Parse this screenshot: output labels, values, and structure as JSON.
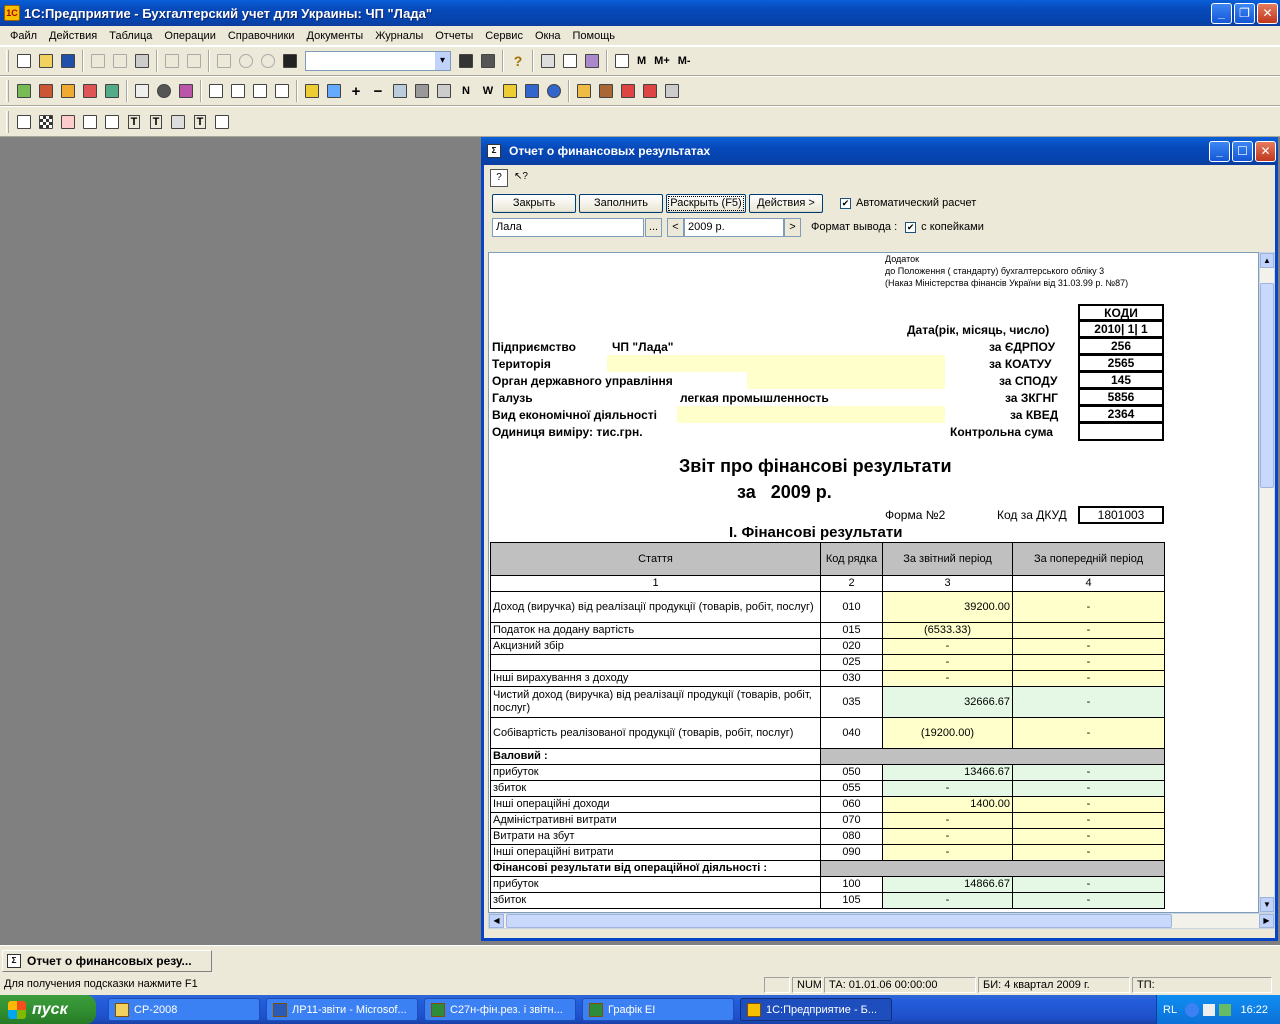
{
  "app": {
    "title": "1С:Предприятие - Бухгалтерский учет для Украины: ЧП \"Лада\"",
    "icon": "1c-app-icon"
  },
  "menu": [
    "Файл",
    "Действия",
    "Таблица",
    "Операции",
    "Справочники",
    "Документы",
    "Журналы",
    "Отчеты",
    "Сервис",
    "Окна",
    "Помощь"
  ],
  "toolbar": {
    "text_buttons": [
      "M",
      "M+",
      "M-"
    ]
  },
  "report_window": {
    "title": "Отчет о финансовых результатах",
    "buttons": {
      "close": "Закрыть",
      "fill": "Заполнить",
      "expand": "Раскрыть (F5)",
      "actions": "Действия >"
    },
    "auto_calc_label": "Автоматический расчет",
    "auto_calc_checked": true,
    "company_value": "Лала",
    "company_select": "...",
    "period_prev": "<",
    "period_value": "2009 р.",
    "period_next": ">",
    "output_format_label": "Формат вывода :",
    "kopecks_label": "с копейками",
    "kopecks_checked": true
  },
  "report": {
    "appendix": [
      "Додаток",
      "до Положення ( стандарту) бухгалтерського обліку 3",
      "(Наказ Міністерства фінансів України від 31.03.99 р. №87)"
    ],
    "codes_header": "КОДИ",
    "date_label": "Дата(рік, місяць, число)",
    "date_value": "2010| 1| 1",
    "rows": [
      {
        "label": "Підприємство",
        "value": "ЧП \"Лада\"",
        "code_label": "за ЄДРПОУ",
        "code": "256"
      },
      {
        "label": "Територія",
        "value": "",
        "code_label": "за  КОАТУУ",
        "code": "2565"
      },
      {
        "label": "Орган державного управління",
        "value": "",
        "code_label": "за СПОДУ",
        "code": "145"
      },
      {
        "label": "Галузь",
        "value": "легкая промышленность",
        "code_label": "за ЗКГНГ",
        "code": "5856"
      },
      {
        "label": "Вид економічної діяльності",
        "value": "",
        "code_label": "за КВЕД",
        "code": "2364"
      },
      {
        "label": "Одиниця виміру: тис.грн.",
        "value": "",
        "code_label": "Контрольна сума",
        "code": ""
      }
    ],
    "title": "Звіт про фінансові результати",
    "subtitle": "за   2009 р.",
    "form_label": "Форма №2",
    "dkud_label": "Код за ДКУД",
    "dkud_value": "1801003",
    "section_title": "І. Фінансові результати",
    "table_headers": [
      "Стаття",
      "Код рядка",
      "За звітний період",
      "За попередній період"
    ],
    "column_numbers": [
      "1",
      "2",
      "3",
      "4"
    ],
    "table_rows": [
      {
        "label": "Доход (виручка) від реалізації продукції (товарів, робіт, послуг)",
        "code": "010",
        "current": "39200.00",
        "previous": "-",
        "style": "y",
        "align": "r",
        "tall": true
      },
      {
        "label": "Податок на додану вартість",
        "code": "015",
        "current": "(6533.33)",
        "previous": "-",
        "style": "y",
        "align": "c"
      },
      {
        "label": "Акцизний збір",
        "code": "020",
        "current": "-",
        "previous": "-",
        "style": "y",
        "align": "c"
      },
      {
        "label": "",
        "code": "025",
        "current": "-",
        "previous": "-",
        "style": "y",
        "align": "c"
      },
      {
        "label": "Інші вирахування з доходу",
        "code": "030",
        "current": "-",
        "previous": "-",
        "style": "y",
        "align": "c"
      },
      {
        "label": "Чистий доход (виручка) від реалізації продукції (товарів, робіт, послуг)",
        "code": "035",
        "current": "32666.67",
        "previous": "-",
        "style": "g",
        "align": "r",
        "tall": true
      },
      {
        "label": "Собівартість реалізованої продукції (товарів, робіт, послуг)",
        "code": "040",
        "current": "(19200.00)",
        "previous": "-",
        "style": "y",
        "align": "c",
        "tall": true
      },
      {
        "label": "Валовий :",
        "section": true
      },
      {
        "label": " прибуток",
        "code": "050",
        "current": "13466.67",
        "previous": "-",
        "style": "g",
        "align": "r"
      },
      {
        "label": " збиток",
        "code": "055",
        "current": "-",
        "previous": "-",
        "style": "g",
        "align": "c"
      },
      {
        "label": "Інші операційні доходи",
        "code": "060",
        "current": "1400.00",
        "previous": "-",
        "style": "y",
        "align": "r"
      },
      {
        "label": "Адміністративні витрати",
        "code": "070",
        "current": "-",
        "previous": "-",
        "style": "y",
        "align": "c"
      },
      {
        "label": "Витрати на збут",
        "code": "080",
        "current": "-",
        "previous": "-",
        "style": "y",
        "align": "c"
      },
      {
        "label": "Інші операційні витрати",
        "code": "090",
        "current": "-",
        "previous": "-",
        "style": "y",
        "align": "c"
      },
      {
        "label": "Фінансові результати від операційної діяльності :",
        "section": true
      },
      {
        "label": " прибуток",
        "code": "100",
        "current": "14866.67",
        "previous": "-",
        "style": "g",
        "align": "r"
      },
      {
        "label": " збиток",
        "code": "105",
        "current": "-",
        "previous": "-",
        "style": "g",
        "align": "c"
      }
    ]
  },
  "window_tab": "Отчет о финансовых резу...",
  "status": {
    "hint": "Для получения подсказки нажмите F1",
    "num": "NUM",
    "ta": "ТА: 01.01.06  00:00:00",
    "bi": "БИ: 4 квартал 2009 г.",
    "tp": "ТП:"
  },
  "taskbar": {
    "start": "пуск",
    "tasks": [
      "СР-2008",
      "ЛР11-звіти - Microsof...",
      "С27н-фін.рез. і звітн...",
      "Графік ЕІ",
      "1С:Предприятие - Б..."
    ],
    "lang": "RL",
    "clock": "16:22"
  },
  "colors": {
    "titlebar": "#0748b8",
    "input_yellow": "#ffffcc",
    "calc_green": "#e5f7e5",
    "workspace": "#808080"
  }
}
